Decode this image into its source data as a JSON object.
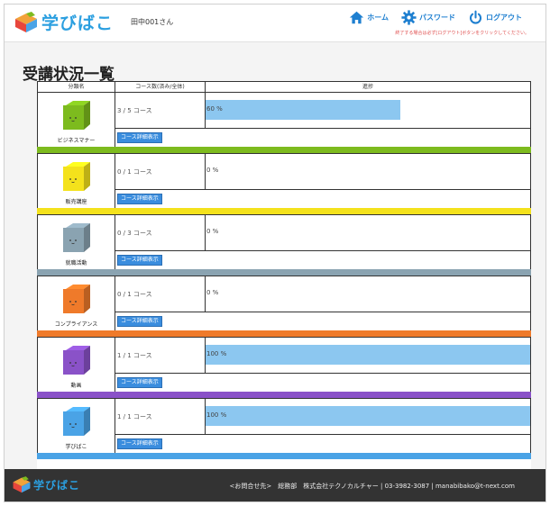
{
  "header": {
    "logo_text": "学びばこ",
    "user_name": "田中001さん",
    "nav": [
      {
        "label": "ホーム",
        "icon": "home-icon"
      },
      {
        "label": "パスワード",
        "icon": "gear-icon"
      },
      {
        "label": "ログアウト",
        "icon": "power-icon"
      }
    ],
    "logout_note": "終了する場合は必ず[ログアウト]ボタンをクリックしてください。"
  },
  "page": {
    "title": "受講状況一覧"
  },
  "table": {
    "headers": [
      "分類名",
      "コース数(済み/全体)",
      "進捗"
    ],
    "detail_label": "コース詳細表示",
    "rows": [
      {
        "category": "ビジネスマナー",
        "count": "3 / 5 コース",
        "progress_label": "60 %",
        "progress": 0.6,
        "color": "#7dbb1e"
      },
      {
        "category": "販売講座",
        "count": "0 / 1 コース",
        "progress_label": "0 %",
        "progress": 0,
        "color": "#f4e21c"
      },
      {
        "category": "就職活動",
        "count": "0 / 3 コース",
        "progress_label": "0 %",
        "progress": 0,
        "color": "#8aa3b1"
      },
      {
        "category": "コンプライアンス",
        "count": "0 / 1 コース",
        "progress_label": "0 %",
        "progress": 0,
        "color": "#ef7a2a"
      },
      {
        "category": "動画",
        "count": "1 / 1 コース",
        "progress_label": "100 %",
        "progress": 1,
        "color": "#8a52c8"
      },
      {
        "category": "学びばこ",
        "count": "1 / 1 コース",
        "progress_label": "100 %",
        "progress": 1,
        "color": "#4aa3e6"
      }
    ]
  },
  "footer": {
    "logo_text": "学びばこ",
    "contact": "<お問合せ先>　総務部　株式会社テクノカルチャー | 03-3982-3087 | manabibako@t-next.com"
  },
  "colors": {
    "brand_blue": "#2b9fe0",
    "bar_fill": "#8cc7f0",
    "button_blue": "#3a8dde",
    "footer_bg": "#333333"
  }
}
